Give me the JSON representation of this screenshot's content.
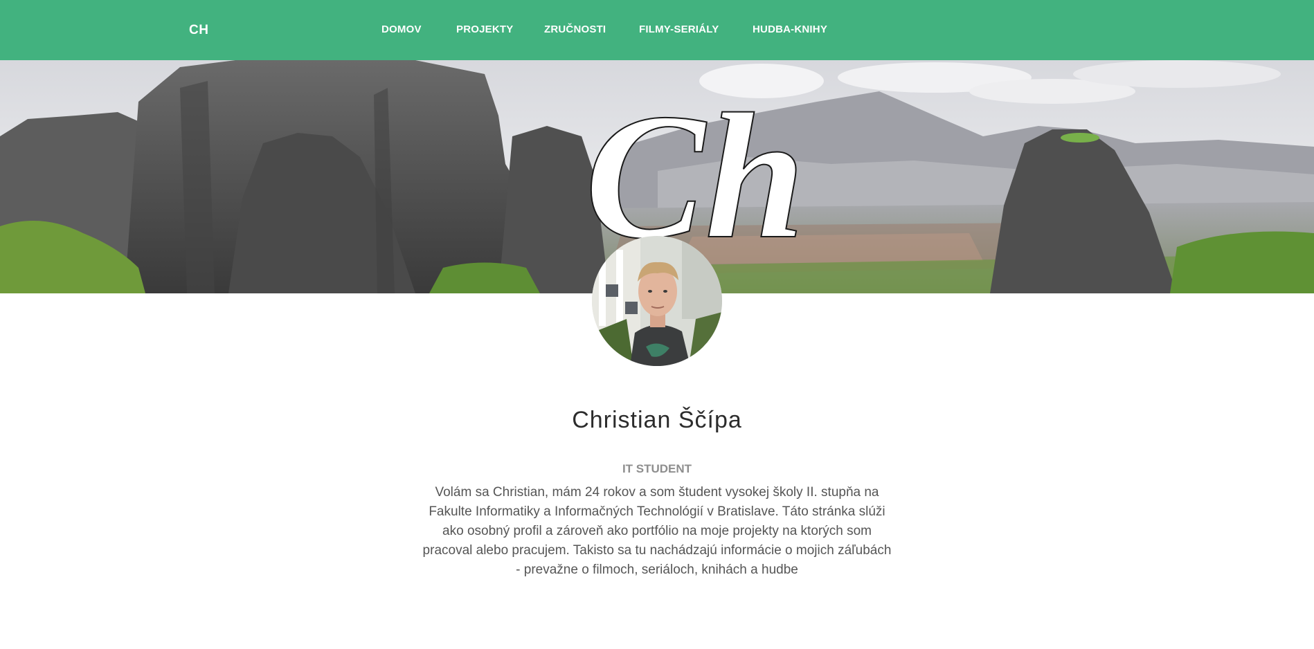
{
  "navbar": {
    "brand": "CH",
    "items": [
      {
        "label": "DOMOV"
      },
      {
        "label": "PROJEKTY"
      },
      {
        "label": "ZRUČNOSTI"
      },
      {
        "label": "FILMY-SERIÁLY"
      },
      {
        "label": "HUDBA-KNIHY"
      }
    ]
  },
  "hero": {
    "logo_text": "Ch"
  },
  "profile": {
    "name": "Christian Ščípa",
    "role": "IT STUDENT",
    "bio": "Volám sa Christian, mám 24 rokov a som študent vysokej školy II. stupňa na Fakulte Informatiky a Informačných Technológií v Bratislave. Táto stránka slúži ako osobný profil a zároveň ako portfólio na moje projekty na ktorých som pracoval alebo pracujem. Takisto sa tu nachádzajú informácie o mojich záľubách - prevažne o filmoch, seriáloch, knihách a hudbe"
  },
  "colors": {
    "nav_background": "#42b27f",
    "nav_text": "#ffffff",
    "name_text": "#2c2c2c",
    "role_text": "#8e8e8e",
    "bio_text": "#555555"
  }
}
